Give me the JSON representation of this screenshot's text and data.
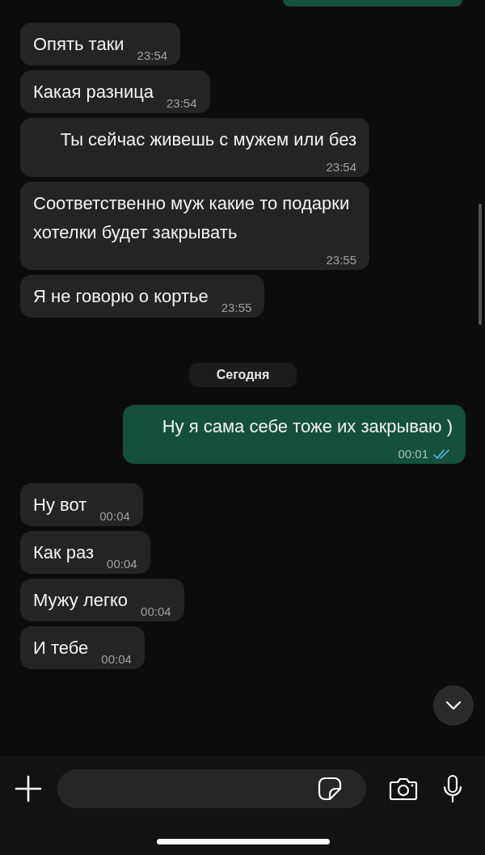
{
  "messages": [
    {
      "kind": "incoming",
      "text": "Опять таки",
      "time": "23:54"
    },
    {
      "kind": "incoming",
      "text": "Какая разница",
      "time": "23:54"
    },
    {
      "kind": "incoming",
      "text": "Ты сейчас живешь с мужем или без",
      "time": "23:54"
    },
    {
      "kind": "incoming",
      "text": "Соответственно муж какие то подарки хотелки будет закрывать",
      "time": "23:55"
    },
    {
      "kind": "incoming",
      "text": "Я не говорю о кортье",
      "time": "23:55"
    },
    {
      "kind": "date",
      "text": "Сегодня"
    },
    {
      "kind": "outgoing",
      "text": "Ну я сама себе тоже их закрываю )",
      "time": "00:01",
      "read": true
    },
    {
      "kind": "incoming",
      "text": "Ну вот",
      "time": "00:04"
    },
    {
      "kind": "incoming",
      "text": "Как раз",
      "time": "00:04"
    },
    {
      "kind": "incoming",
      "text": "Мужу легко",
      "time": "00:04"
    },
    {
      "kind": "incoming",
      "text": "И тебе",
      "time": "00:04"
    }
  ]
}
